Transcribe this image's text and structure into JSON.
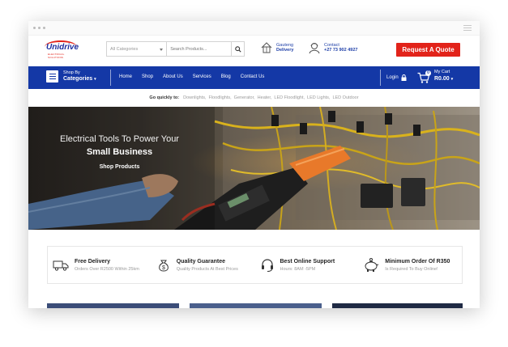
{
  "header": {
    "logo_text": "Unidrive",
    "logo_subtext": "ELECTRICAL SOLUTIONS",
    "search": {
      "category_label": "All Categories",
      "placeholder": "Search Products..."
    },
    "delivery": {
      "line1": "Gauteng",
      "line2": "Delivery"
    },
    "contact": {
      "line1": "Contact",
      "line2": "+27 73 902 4927"
    },
    "quote_button": "Request A Quote"
  },
  "nav": {
    "shop_by_line1": "Shop By",
    "shop_by_line2": "Categories",
    "links": [
      "Home",
      "Shop",
      "About Us",
      "Services",
      "Blog",
      "Contact Us"
    ],
    "login_label": "Login",
    "cart": {
      "label": "My Cart",
      "total": "R0.00",
      "count": "0"
    }
  },
  "quick_links": {
    "label": "Go quickly to:",
    "items": [
      "Downlights,",
      "Floodlights,",
      "Generator,",
      "Heater,",
      "LED Floodlight,",
      "LED Lights,",
      "LED Outdoor"
    ]
  },
  "hero": {
    "line1": "Electrical Tools To Power Your",
    "line2": "Small Business",
    "cta": "Shop Products"
  },
  "features": [
    {
      "icon": "truck-icon",
      "title": "Free Delivery",
      "subtitle": "Orders Over R2500 Within 25km"
    },
    {
      "icon": "money-bag-icon",
      "title": "Quality Guarantee",
      "subtitle": "Quality Products At Best Prices"
    },
    {
      "icon": "headset-icon",
      "title": "Best Online Support",
      "subtitle": "Hours: 8AM -5PM"
    },
    {
      "icon": "piggy-bank-icon",
      "title": "Minimum Order Of R350",
      "subtitle": "Is Required To Buy Online!"
    }
  ],
  "colors": {
    "brand_blue": "#1438a6",
    "accent_red": "#e2231a"
  }
}
